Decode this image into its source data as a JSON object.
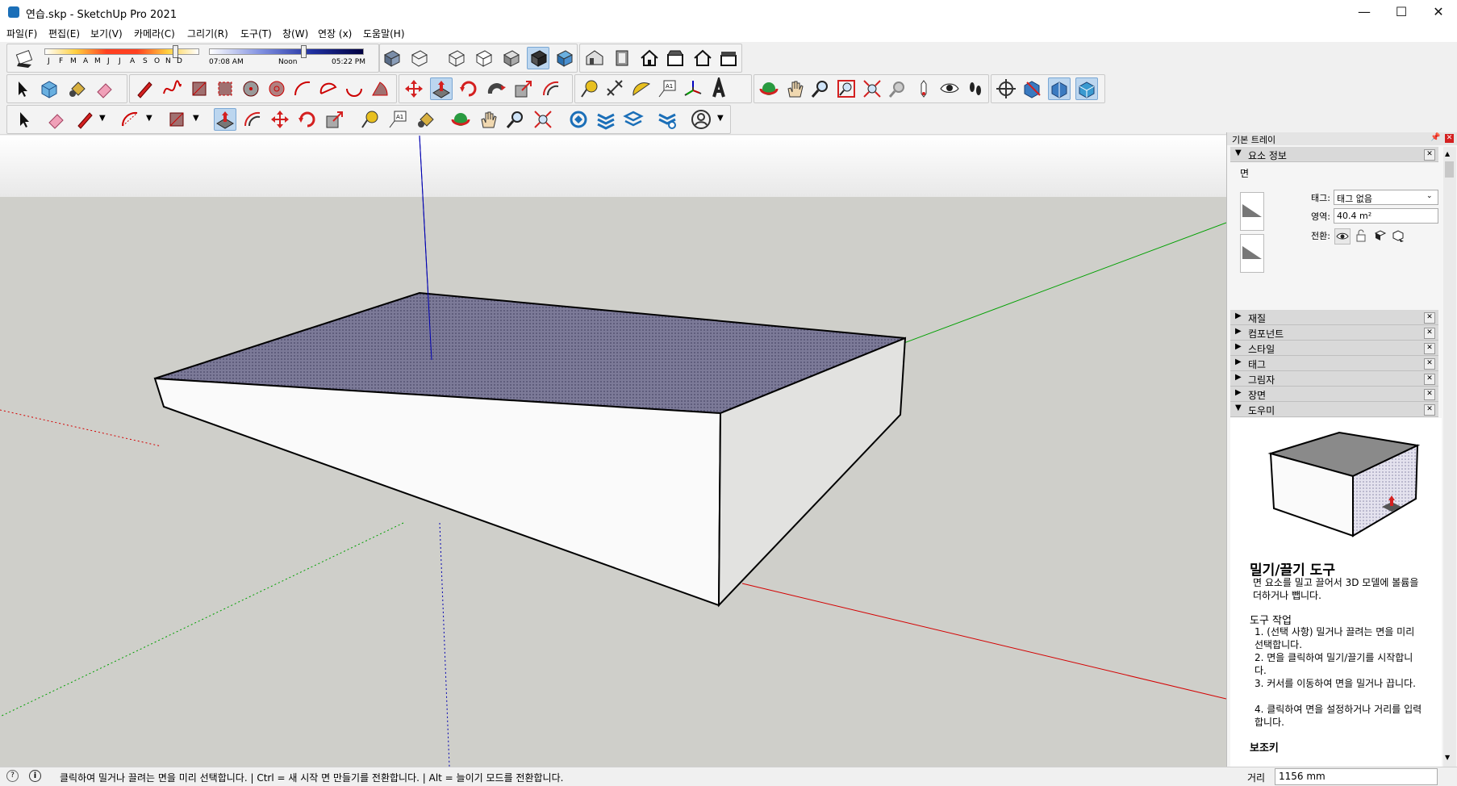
{
  "window": {
    "title": "연습.skp - SketchUp Pro 2021",
    "minimize": "—",
    "maximize": "☐",
    "close": "✕"
  },
  "menu": [
    "파일(F)",
    "편집(E)",
    "보기(V)",
    "카메라(C)",
    "그리기(R)",
    "도구(T)",
    "창(W)",
    "연장 (x)",
    "도움말(H)"
  ],
  "shadows": {
    "months": [
      "J",
      "F",
      "M",
      "A",
      "M",
      "J",
      "J",
      "A",
      "S",
      "O",
      "N",
      "D"
    ],
    "time_start": "07:08 AM",
    "time_mid": "Noon",
    "time_end": "05:22 PM"
  },
  "tray": {
    "title": "기본 트레이",
    "entity_info": {
      "header": "요소 정보",
      "type": "면",
      "tag_label": "태그:",
      "tag_value": "태그 없음",
      "area_label": "영역:",
      "area_value": "40.4 m²",
      "toggle_label": "전환:"
    },
    "panels": [
      "재질",
      "컴포넌트",
      "스타일",
      "태그",
      "그림자",
      "장면"
    ],
    "instructor": {
      "header": "도우미",
      "tool_title": "밀기/끌기 도구",
      "description": "면 요소를 밀고 끌어서 3D 모델에 볼륨을 더하거나 뺍니다.",
      "ops_title": "도구 작업",
      "steps": [
        "1. (선택 사항) 밀거나 끌려는 면을 미리 선택합니다.",
        "2. 면을 클릭하여 밀기/끌기를 시작합니다.",
        "3. 커서를 이동하여 면을 밀거나 끕니다.",
        "4. 클릭하여 면을 설정하거나 거리를 입력합니다."
      ],
      "modifier_title": "보조키"
    }
  },
  "status": {
    "text": "클릭하여 밀거나 끌려는 면을 미리 선택합니다. | Ctrl = 새 시작 면 만들기를 전환합니다. | Alt = 늘이기 모드를 전환합니다.",
    "measure_label": "거리",
    "measure_value": "1156 mm"
  },
  "colors": {
    "axis_red": "#d40000",
    "axis_green": "#00a000",
    "axis_blue": "#0000b0",
    "sky": "#f4f4f4",
    "ground": "#cfcfca",
    "face_selected": "#7a7896",
    "accent": "#1b6fb8"
  }
}
